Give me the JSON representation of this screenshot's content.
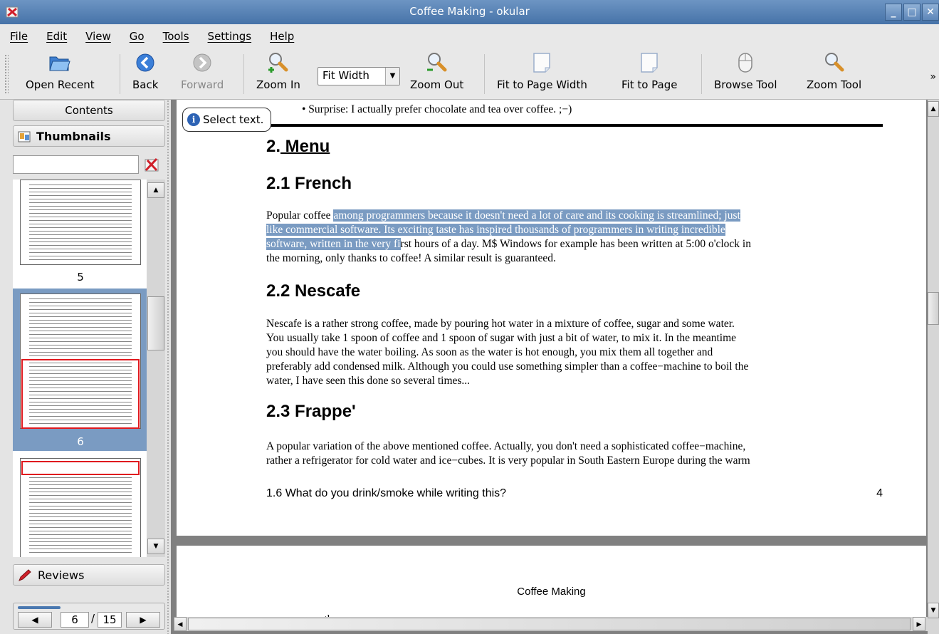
{
  "window": {
    "title": "Coffee Making - okular",
    "min": "_",
    "max": "□",
    "close": "✕"
  },
  "menu": [
    "File",
    "Edit",
    "View",
    "Go",
    "Tools",
    "Settings",
    "Help"
  ],
  "toolbar": {
    "open_recent": "Open Recent",
    "back": "Back",
    "forward": "Forward",
    "zoom_in": "Zoom In",
    "zoom_select": "Fit Width",
    "zoom_out": "Zoom Out",
    "fit_width": "Fit to Page Width",
    "fit_page": "Fit to Page",
    "browse_tool": "Browse Tool",
    "zoom_tool": "Zoom Tool",
    "more": "»"
  },
  "sidebar": {
    "contents": "Contents",
    "thumbnails": "Thumbnails",
    "reviews": "Reviews",
    "thumbs": [
      {
        "num": "5"
      },
      {
        "num": "6"
      }
    ],
    "pager": {
      "current": "6",
      "sep": "/",
      "total": "15"
    }
  },
  "tooltip": {
    "text": "Select text."
  },
  "page1": {
    "bullet": "• Surprise: I actually prefer chocolate and tea over coffee. ;−)",
    "h_menu_num": "2.",
    "h_menu": " Menu",
    "h_french": "2.1 French",
    "p_french_a": "Popular coffee ",
    "p_french_hl1": "among programmers because it doesn't need a lot of care and its cooking is streamlined; just",
    "p_french_hl2": "like commercial software. Its exciting taste has inspired thousands of programmers in writing incredible",
    "p_french_hl3": "software, written in the very fi",
    "p_french_b": "rst hours of a day. M$ Windows for example has been written at 5:00 o'clock in",
    "p_french_c": "the morning, only thanks to coffee! A similar result is guaranteed.",
    "h_nescafe": "2.2 Nescafe",
    "p_nescafe": [
      "Nescafe is a rather strong coffee, made by pouring hot water in a mixture of coffee, sugar and some water.",
      "You usually take 1 spoon of coffee and 1 spoon of sugar with just a bit of water, to mix it. In the meantime",
      "you should have the water boiling. As soon as the water is hot enough, you mix them all together and",
      "preferably add condensed milk. Although you could use something simpler than a coffee−machine to boil the",
      "water, I have seen this done so several times..."
    ],
    "h_frappe": "2.3 Frappe'",
    "p_frappe": [
      "A popular variation of the above mentioned coffee. Actually, you don't need a sophisticated coffee−machine,",
      "rather a refrigerator for cold water and ice−cubes. It is very popular in South Eastern Europe during the warm"
    ],
    "footer_title": "1.6 What do you drink/smoke while writing this?",
    "footer_num": "4"
  },
  "page2": {
    "header": "Coffee Making",
    "text": "summer months."
  }
}
